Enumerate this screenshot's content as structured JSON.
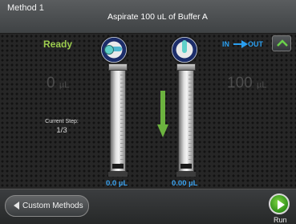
{
  "header": {
    "method": "Method 1",
    "title": "Aspirate 100 uL of Buffer A"
  },
  "left_panel": {
    "status": "Ready",
    "volume": "0",
    "volume_unit": "µL",
    "current_step_label": "Current Step:",
    "current_step_value": "1/3"
  },
  "right_panel": {
    "volume": "100",
    "volume_unit": "µL",
    "flow_in_label": "IN",
    "flow_out_label": "OUT"
  },
  "syringes": [
    {
      "amount": "0.0 µL",
      "valve": "left"
    },
    {
      "amount": "0.00 µL",
      "valve": "right"
    }
  ],
  "footer": {
    "custom_methods_label": "Custom Methods",
    "run_label": "Run"
  },
  "icons": [
    "chevron-up-icon",
    "arrow-right-icon",
    "arrow-down-icon",
    "play-icon",
    "triangle-left-icon"
  ],
  "colors": {
    "ready": "#9ccc4e",
    "accent_blue": "#2a9ff0",
    "run_green": "#4fb52c",
    "arrow_green": "#6cb33f"
  }
}
